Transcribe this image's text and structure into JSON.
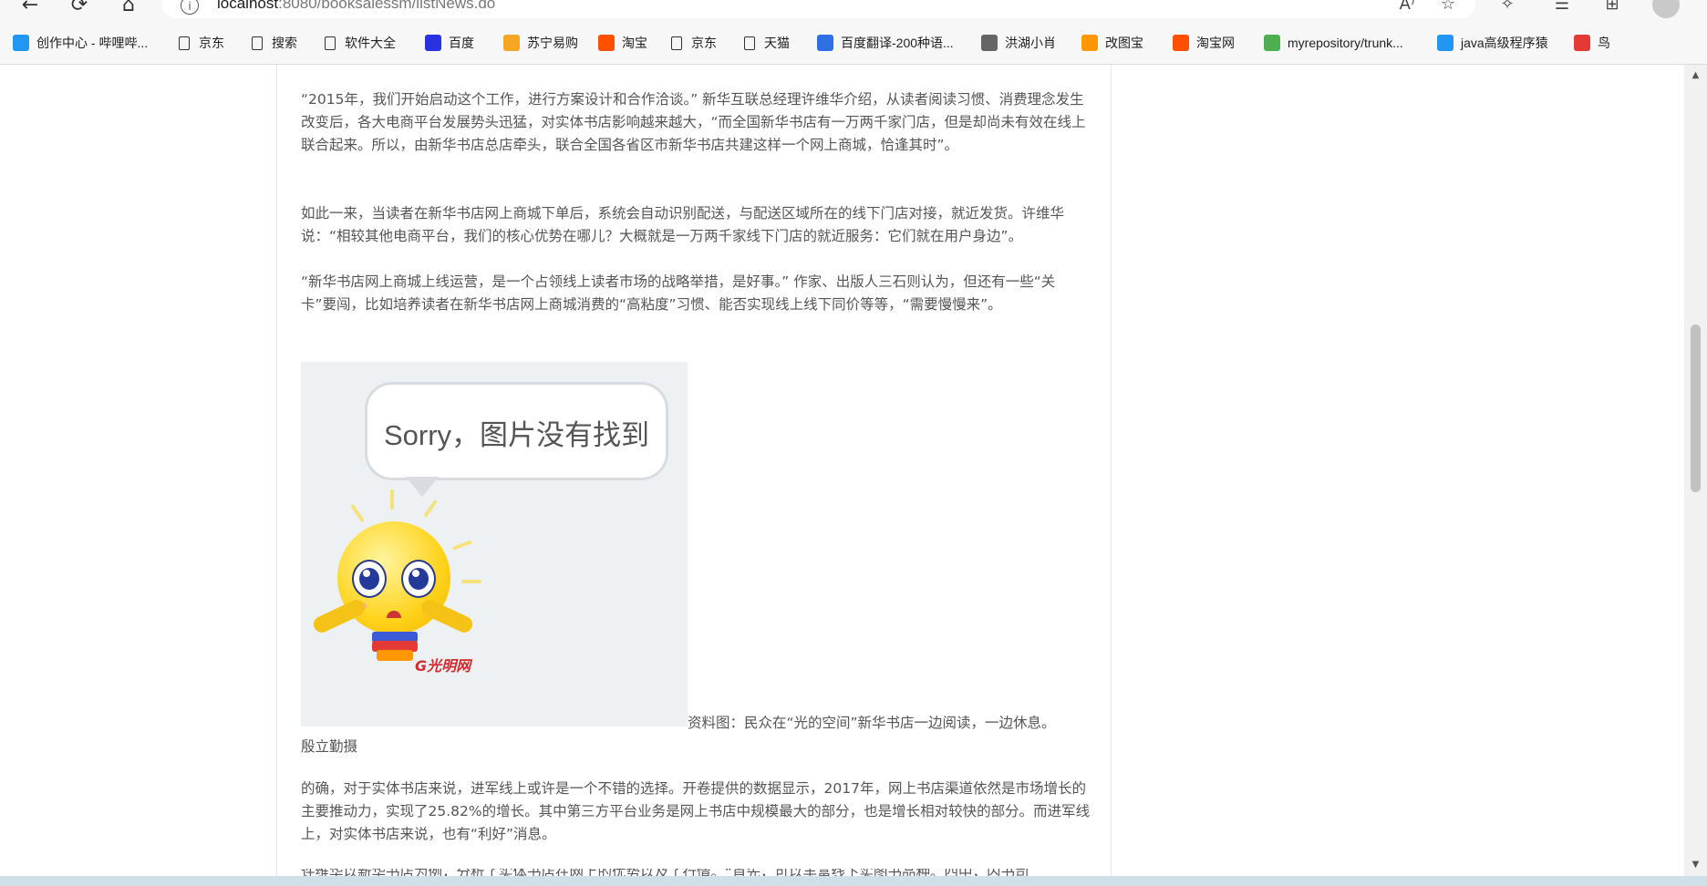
{
  "browser": {
    "url_host": "localhost",
    "url_rest": ":8080/booksalessm/listNews.do",
    "nav": {
      "back_icon": "←",
      "reload_icon": "⟳",
      "home_icon": "⌂"
    }
  },
  "bookmarks": [
    {
      "label": "创作中心 - 哔哩哔...",
      "icon": "bilibili-icon",
      "color": "#2196f3"
    },
    {
      "label": "京东",
      "icon": "doc-icon"
    },
    {
      "label": "搜索",
      "icon": "doc-icon"
    },
    {
      "label": "软件大全",
      "icon": "doc-icon"
    },
    {
      "label": "百度",
      "icon": "baidu-icon",
      "color": "#2932e1"
    },
    {
      "label": "苏宁易购",
      "icon": "suning-icon",
      "color": "#f5a623"
    },
    {
      "label": "淘宝",
      "icon": "taobao-icon",
      "color": "#ff5000"
    },
    {
      "label": "京东",
      "icon": "doc-icon"
    },
    {
      "label": "天猫",
      "icon": "doc-icon"
    },
    {
      "label": "百度翻译-200种语...",
      "icon": "fanyi-icon",
      "color": "#2f6fe4"
    },
    {
      "label": "洪湖小肖",
      "icon": "hh-icon",
      "color": "#666"
    },
    {
      "label": "改图宝",
      "icon": "gaitubao-icon",
      "color": "#ff9800"
    },
    {
      "label": "淘宝网",
      "icon": "taobao-icon",
      "color": "#ff5000"
    },
    {
      "label": "myrepository/trunk...",
      "icon": "chrome-icon",
      "color": "#4caf50"
    },
    {
      "label": "java高级程序猿",
      "icon": "bilibili-icon",
      "color": "#2196f3"
    },
    {
      "label": "鸟",
      "icon": "bird-icon",
      "color": "#e53935"
    }
  ],
  "article": {
    "p1": "“2015年，我们开始启动这个工作，进行方案设计和合作洽谈。” 新华互联总经理许维华介绍，从读者阅读习惯、消费理念发生改变后，各大电商平台发展势头迅猛，对实体书店影响越来越大，“而全国新华书店有一万两千家门店，但是却尚未有效在线上联合起来。所以，由新华书店总店牵头，联合全国各省区市新华书店共建这样一个网上商城，恰逢其时”。",
    "p2": "如此一来，当读者在新华书店网上商城下单后，系统会自动识别配送，与配送区域所在的线下门店对接，就近发货。许维华说：“相较其他电商平台，我们的核心优势在哪儿？大概就是一万两千家线下门店的就近服务：它们就在用户身边”。",
    "p3": "“新华书店网上商城上线运营，是一个占领线上读者市场的战略举措，是好事。” 作家、出版人三石则认为，但还有一些“关卡”要闯，比如培养读者在新华书店网上商城消费的“高粘度”习惯、能否实现线上线下同价等等，“需要慢慢来”。",
    "image_error_text": "Sorry，图片没有找到",
    "image_logo": "G光明网",
    "caption": "资料图：民众在“光的空间”新华书店一边阅读，一边休息。",
    "caption_author": "殷立勤摄",
    "p4": "的确，对于实体书店来说，进军线上或许是一个不错的选择。开卷提供的数据显示，2017年，网上书店渠道依然是市场增长的主要推动力，实现了25.82%的增长。其中第三方平台业务是网上书店中规模最大的部分，也是增长相对较快的部分。而进军线上，对实体书店来说，也有“利好”消息。",
    "p5": "许维华以新华书店为例，分析了实体书店在网上的优势以及了行情。“首先，可以丰富线下实图书品种。四中，内书司"
  }
}
